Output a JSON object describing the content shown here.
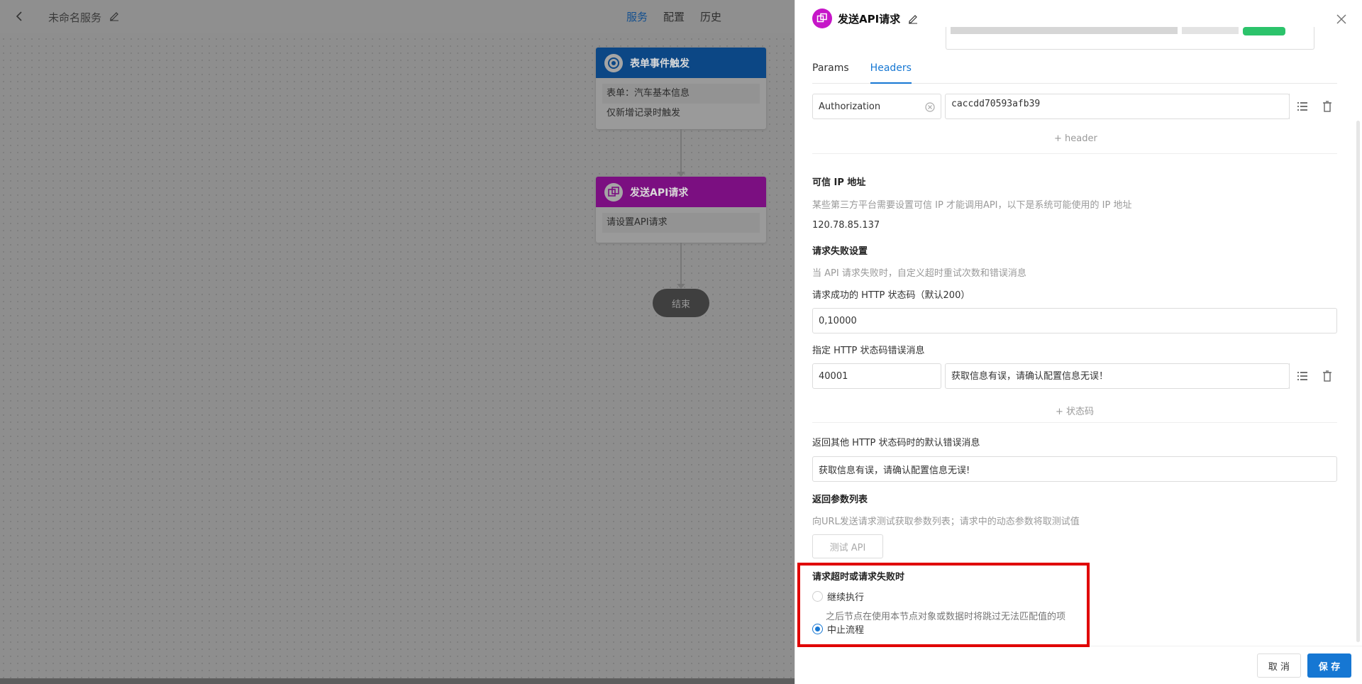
{
  "topbar": {
    "service_name": "未命名服务",
    "tabs": [
      "服务",
      "配置",
      "历史"
    ],
    "active_tab": "服务"
  },
  "flow": {
    "trigger": {
      "title": "表单事件触发",
      "form_label": "表单：汽车基本信息",
      "condition": "仅新增记录时触发"
    },
    "api_node": {
      "title": "发送API请求",
      "body": "请设置API请求"
    },
    "end_label": "结束"
  },
  "drawer": {
    "title": "发送API请求",
    "tabs": [
      "Params",
      "Headers"
    ],
    "active_tab": "Headers",
    "headers": {
      "key": "Authorization",
      "value": "caccdd70593afb39",
      "add_label": "+ header"
    },
    "trusted_ip": {
      "title": "可信 IP 地址",
      "hint": "某些第三方平台需要设置可信 IP 才能调用API，以下是系统可能使用的 IP 地址",
      "ip": "120.78.85.137"
    },
    "failure": {
      "title": "请求失败设置",
      "hint": "当 API 请求失败时，自定义超时重试次数和错误消息",
      "success_code_label": "请求成功的 HTTP 状态码（默认200）",
      "success_code_value": "0,10000",
      "error_msg_label": "指定 HTTP 状态码错误消息",
      "error_code": "40001",
      "error_msg": "获取信息有误，请确认配置信息无误！",
      "add_code_label": "+ 状态码",
      "default_msg_label": "返回其他 HTTP 状态码时的默认错误消息",
      "default_msg_value": "获取信息有误，请确认配置信息无误!"
    },
    "return_params": {
      "title": "返回参数列表",
      "hint": "向URL发送请求测试获取参数列表；请求中的动态参数将取测试值",
      "test_button": "测试 API"
    },
    "timeout": {
      "title": "请求超时或请求失败时",
      "continue_label": "继续执行",
      "continue_hint": "之后节点在使用本节点对象或数据时将跳过无法匹配值的项",
      "stop_label": "中止流程",
      "selected": "stop"
    },
    "footer": {
      "cancel": "取 消",
      "save": "保 存"
    }
  },
  "colors": {
    "accent": "#1677d3",
    "api_node": "#c616c8",
    "highlight": "#e00000"
  }
}
